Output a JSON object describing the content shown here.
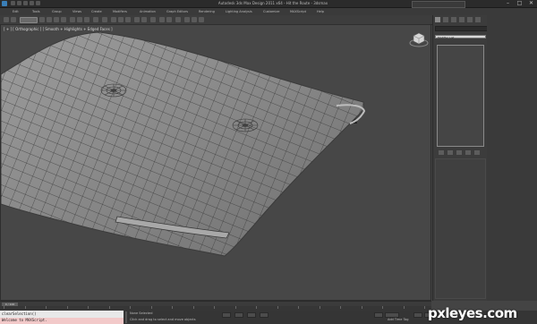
{
  "titlebar": {
    "title": "Autodesk 3ds Max Design 2011 x64   -   Hit the Route - 3dsmax",
    "min": "–",
    "max": "□",
    "close": "✕"
  },
  "menubar": {
    "items": [
      "Edit",
      "Tools",
      "Group",
      "Views",
      "Create",
      "Modifiers",
      "Animation",
      "Graph Editors",
      "Rendering",
      "Lighting Analysis",
      "Customize",
      "MAXScript",
      "Help"
    ]
  },
  "viewport": {
    "label": "[ + ] [ Orthographic ] [ Smooth + Highlights + Edged Faces ]"
  },
  "cmdpanel": {
    "modifier_list": "Modifier List"
  },
  "timeslider": {
    "frame": "0 / 100"
  },
  "status": {
    "maxscript_line1": "clearSelection()",
    "maxscript_line2": "Welcome to MAXScript.",
    "selection": "None Selected",
    "prompt": "Click and drag to select and move objects",
    "add_time_tag": "Add Time Tag",
    "frame_value": "0"
  },
  "watermark": "pxleyes.com"
}
